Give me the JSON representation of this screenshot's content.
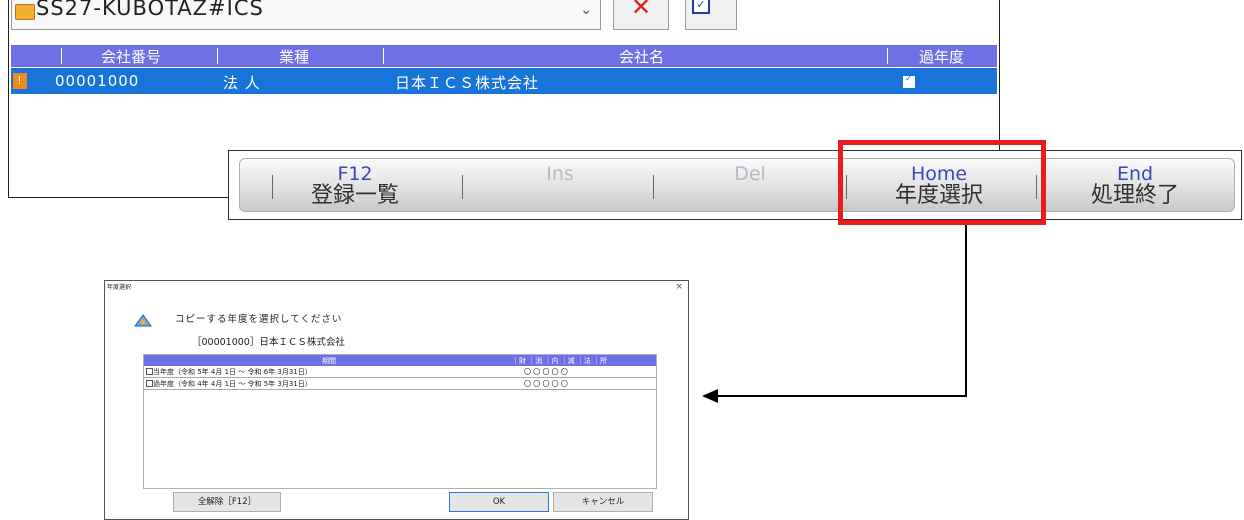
{
  "list_window": {
    "db_name": "SS27-KUBOTAZ#ICS",
    "columns": [
      "会社番号",
      "業種",
      "会社名",
      "過年度"
    ],
    "row": {
      "marker": "!",
      "code": "00001000",
      "industry": "法 人",
      "company": "日本ＩＣＳ株式会社"
    }
  },
  "fkeys": [
    {
      "key": "F12",
      "label": "登録一覧",
      "enabled": true
    },
    {
      "key": "Ins",
      "label": "",
      "enabled": false
    },
    {
      "key": "Del",
      "label": "",
      "enabled": false
    },
    {
      "key": "Home",
      "label": "年度選択",
      "enabled": true
    },
    {
      "key": "End",
      "label": "処理終了",
      "enabled": true
    }
  ],
  "dialog": {
    "title": "年度選択",
    "close": "×",
    "message": "コピーする年度を選択してください",
    "company": "［00001000］日本ＩＣＳ株式会社",
    "grid_header": {
      "period": "期間",
      "cols": "｜財 ｜消 ｜内 ｜減 ｜法 ｜所"
    },
    "rows": [
      {
        "label": "当年度（令和 5年 4月 1日 ～ 令和 6年 3月31日）",
        "marks": "〇  〇  〇  〇  〇"
      },
      {
        "label": "過年度（令和 4年 4月 1日 ～ 令和 5年 3月31日）",
        "marks": "〇  〇  〇  〇  〇"
      }
    ],
    "btn_clear": "全解除［F12］",
    "btn_ok": "OK",
    "btn_cancel": "キャンセル"
  },
  "colors": {
    "header": "#6f6fe6",
    "selected_row": "#1874d9",
    "highlight": "#ec1c1c"
  }
}
